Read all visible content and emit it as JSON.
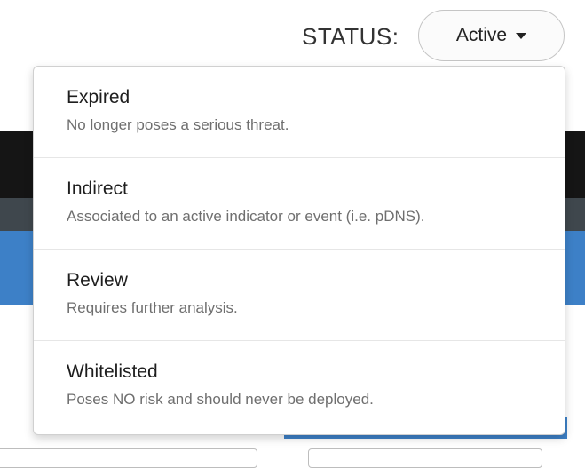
{
  "status": {
    "label": "STATUS:",
    "selected": "Active",
    "caret_icon": "caret-down-icon"
  },
  "menu": {
    "items": [
      {
        "title": "Expired",
        "description": "No longer poses a serious threat."
      },
      {
        "title": "Indirect",
        "description": "Associated to an active indicator or event (i.e. pDNS)."
      },
      {
        "title": "Review",
        "description": "Requires further analysis."
      },
      {
        "title": "Whitelisted",
        "description": "Poses NO risk and should never be deployed."
      }
    ]
  },
  "colors": {
    "header_dark": "#151515",
    "nav_gray": "#3f474d",
    "accent_blue": "#3d80c7"
  }
}
